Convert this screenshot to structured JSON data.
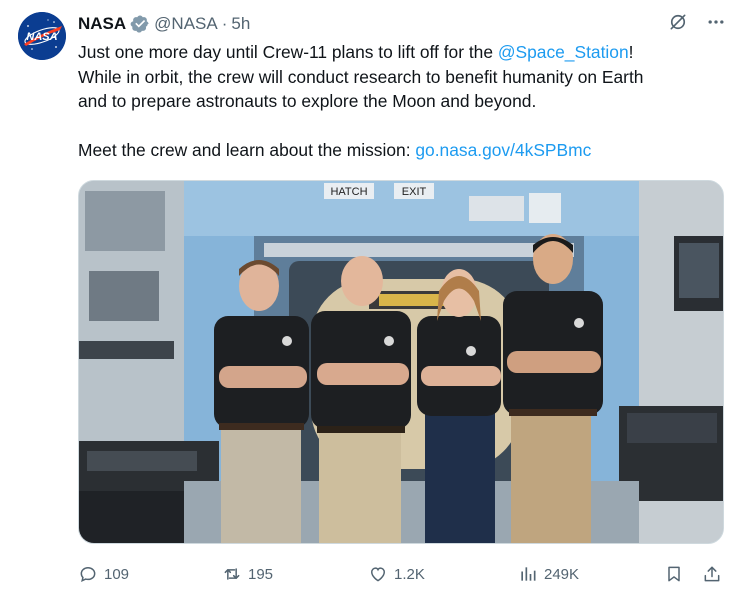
{
  "author": {
    "name": "NASA",
    "handle": "@NASA",
    "separator": "·",
    "time": "5h",
    "avatar_text": "NASA"
  },
  "tweet": {
    "line1_pre": "Just one more day until Crew-11 plans to lift off for the ",
    "mention": "@Space_Station",
    "line1_post": "!",
    "line2": "While in orbit, the crew will conduct research to benefit humanity on Earth",
    "line3": "and to prepare astronauts to explore the Moon and beyond.",
    "line5_pre": "Meet the crew and learn about the mission: ",
    "url": "go.nasa.gov/4kSPBmc"
  },
  "media": {
    "sign_hatch": "HATCH",
    "sign_exit": "EXIT"
  },
  "actions": {
    "replies": "109",
    "reposts": "195",
    "likes": "1.2K",
    "views": "249K"
  },
  "colors": {
    "link": "#1d9bf0",
    "secondary_text": "#536471",
    "verified_badge": "#829aab",
    "module_wall": "#86b4d9"
  }
}
